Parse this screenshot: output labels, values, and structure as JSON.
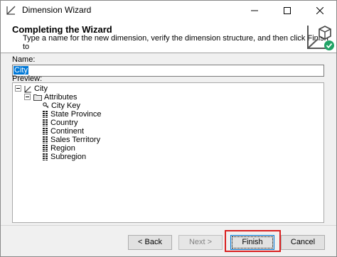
{
  "window": {
    "title": "Dimension Wizard",
    "icon": "dimension-wizard-icon"
  },
  "header": {
    "title": "Completing the Wizard",
    "subtitle": "Type a name for the new dimension, verify the dimension structure, and then click Finish to",
    "icon": "dimension-cube-check-icon"
  },
  "form": {
    "name_label": "Name:",
    "name_value": "City",
    "preview_label": "Preview:"
  },
  "tree": {
    "root": "City",
    "attributes_label": "Attributes",
    "attributes": [
      "City Key",
      "State Province",
      "Country",
      "Continent",
      "Sales Territory",
      "Region",
      "Subregion"
    ]
  },
  "buttons": {
    "back": "< Back",
    "next": "Next >",
    "finish": "Finish",
    "cancel": "Cancel"
  },
  "colors": {
    "accent": "#0078d7",
    "highlight": "#d92020"
  }
}
